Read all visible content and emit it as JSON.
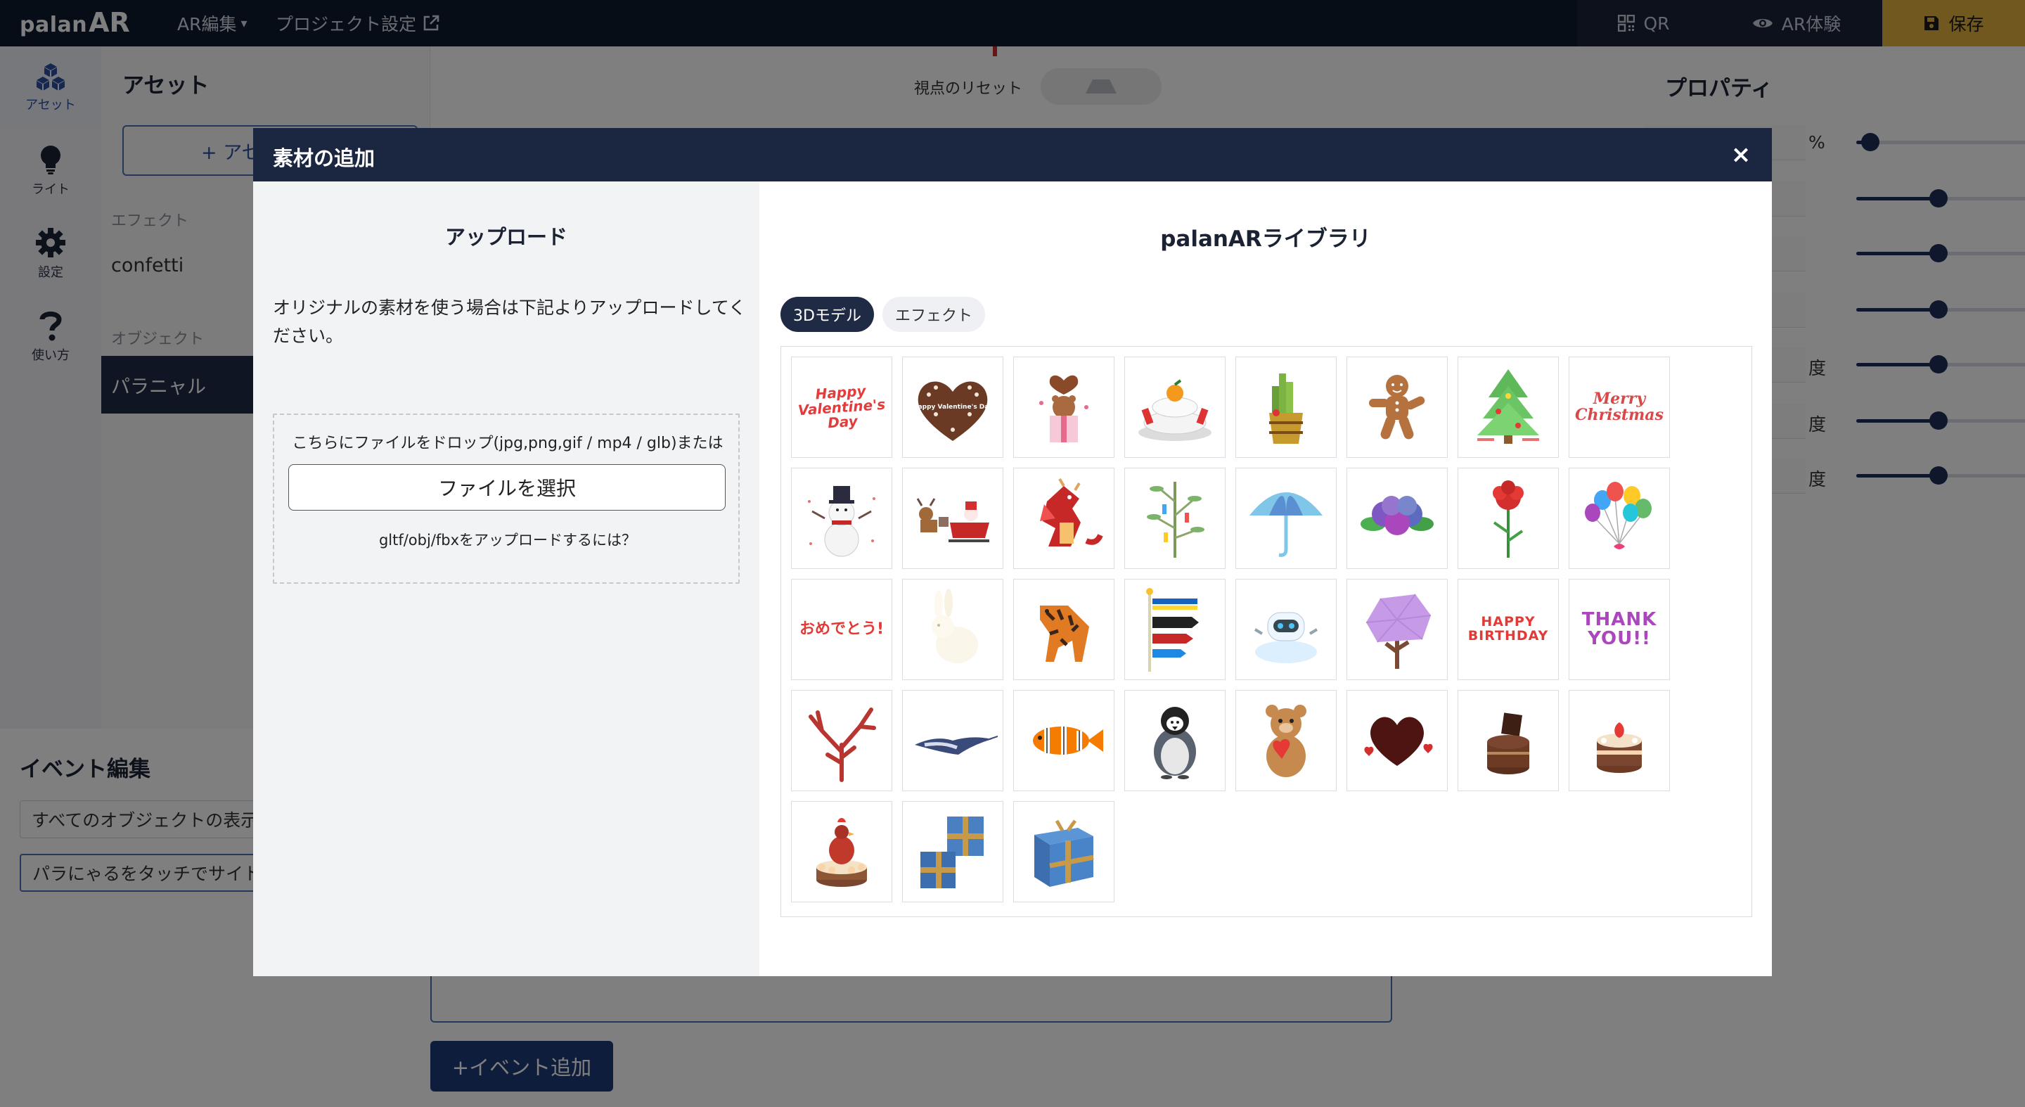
{
  "app": {
    "logo_text_1": "palan",
    "logo_text_2": "AR",
    "menu_ar_edit": "AR編集",
    "menu_project_settings": "プロジェクト設定",
    "btn_qr": "QR",
    "btn_ar_experience": "AR体験",
    "btn_save": "保存"
  },
  "rail": [
    {
      "label": "アセット",
      "icon": "cubes-icon"
    },
    {
      "label": "ライト",
      "icon": "bulb-icon"
    },
    {
      "label": "設定",
      "icon": "gear-icon"
    },
    {
      "label": "使い方",
      "icon": "question-icon"
    }
  ],
  "asset_panel": {
    "title": "アセット",
    "add_button": "+ アセ",
    "section_effect": "エフェクト",
    "effect_item": "confetti",
    "section_object": "オブジェクト",
    "object_item": "パラニャル"
  },
  "stage": {
    "view_reset": "視点のリセット"
  },
  "properties": {
    "title": "プロパティ",
    "rows": [
      {
        "unit": "%",
        "value": 0.08
      },
      {
        "unit": "",
        "value": 0.47
      },
      {
        "unit": "",
        "value": 0.47
      },
      {
        "unit": "",
        "value": 0.47
      },
      {
        "unit": "度",
        "value": 0.47
      },
      {
        "unit": "度",
        "value": 0.47
      },
      {
        "unit": "度",
        "value": 0.47
      }
    ]
  },
  "events": {
    "title": "イベント編集",
    "row1": "すべてのオブジェクトの表示",
    "row2": "パラにゃるをタッチでサイト",
    "add_button": "+イベント追加"
  },
  "modal": {
    "title": "素材の追加",
    "close": "×",
    "upload": {
      "title": "アップロード",
      "description": "オリジナルの素材を使う場合は下記よりアップロードしてください。",
      "drop_text": "こちらにファイルをドロップ(jpg,png,gif / mp4 / glb)または",
      "file_button": "ファイルを選択",
      "gltf_link": "gltf/obj/fbxをアップロードするには？"
    },
    "library": {
      "title": "palanARライブラリ",
      "tabs": [
        {
          "label": "3Dモデル",
          "active": true
        },
        {
          "label": "エフェクト",
          "active": false
        }
      ],
      "items": [
        {
          "name": "happy-valentines-text",
          "text": "Happy Valentine's Day"
        },
        {
          "name": "valentine-heart-cookie",
          "text": "Happy Valentine's Day"
        },
        {
          "name": "bear-gift-box"
        },
        {
          "name": "kagami-mochi"
        },
        {
          "name": "kadomatsu"
        },
        {
          "name": "gingerbread-man"
        },
        {
          "name": "christmas-tree"
        },
        {
          "name": "merry-christmas-text",
          "text": "Merry Christmas"
        },
        {
          "name": "snowman"
        },
        {
          "name": "santa-sleigh"
        },
        {
          "name": "red-dragon"
        },
        {
          "name": "tanabata-bamboo"
        },
        {
          "name": "umbrella"
        },
        {
          "name": "hydrangea"
        },
        {
          "name": "carnation"
        },
        {
          "name": "balloons"
        },
        {
          "name": "omedetou-text",
          "text": "おめでとう!"
        },
        {
          "name": "white-rabbit"
        },
        {
          "name": "tiger"
        },
        {
          "name": "koinobori"
        },
        {
          "name": "robot-cloud"
        },
        {
          "name": "sakura-tree"
        },
        {
          "name": "happy-birthday-text",
          "text": "HAPPY BIRTHDAY"
        },
        {
          "name": "thank-you-text",
          "text": "THANK YOU!!"
        },
        {
          "name": "red-coral"
        },
        {
          "name": "manta-ray"
        },
        {
          "name": "clownfish"
        },
        {
          "name": "penguin"
        },
        {
          "name": "teddy-bear-heart"
        },
        {
          "name": "chocolate-heart"
        },
        {
          "name": "chocolate-cake"
        },
        {
          "name": "strawberry-cake"
        },
        {
          "name": "rooster-cake"
        },
        {
          "name": "blue-gift-boxes"
        },
        {
          "name": "blue-gift-box"
        }
      ]
    }
  },
  "colors": {
    "topbar": "#0f1a2f",
    "save_button": "#e2b13c",
    "modal_header": "#1b2640",
    "accent": "#1f2a44"
  }
}
